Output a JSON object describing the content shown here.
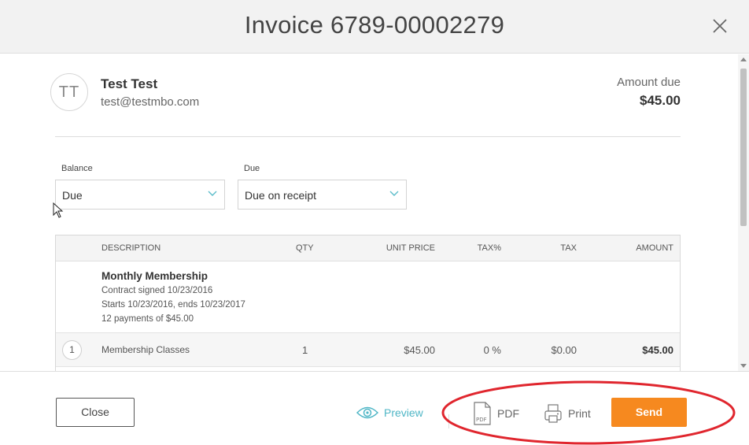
{
  "header": {
    "title": "Invoice 6789-00002279"
  },
  "customer": {
    "initials": "TT",
    "name": "Test Test",
    "email": "test@testmbo.com"
  },
  "amount_due": {
    "label": "Amount due",
    "value": "$45.00"
  },
  "fields": {
    "balance": {
      "label": "Balance",
      "value": "Due"
    },
    "due": {
      "label": "Due",
      "value": "Due on receipt"
    }
  },
  "table": {
    "columns": {
      "description": "DESCRIPTION",
      "qty": "QTY",
      "unit_price": "UNIT PRICE",
      "tax_pct": "TAX%",
      "tax": "TAX",
      "amount": "AMOUNT"
    },
    "item": {
      "title": "Monthly Membership",
      "details": [
        "Contract signed 10/23/2016",
        "Starts 10/23/2016, ends 10/23/2017",
        "12 payments of $45.00"
      ]
    },
    "lines": [
      {
        "num": "1",
        "description": "Membership Classes",
        "qty": "1",
        "unit_price": "$45.00",
        "tax_pct": "0 %",
        "tax": "$0.00",
        "amount": "$45.00"
      }
    ]
  },
  "footer": {
    "close": "Close",
    "preview": "Preview",
    "pdf": "PDF",
    "print": "Print",
    "send": "Send"
  },
  "colors": {
    "accent_teal": "#4fb6c6",
    "send_orange": "#f6891f",
    "highlight_red": "#e0262e"
  },
  "icons": [
    "close-icon",
    "chevron-down-icon",
    "eye-icon",
    "pdf-icon",
    "printer-icon",
    "mouse-cursor-icon"
  ]
}
